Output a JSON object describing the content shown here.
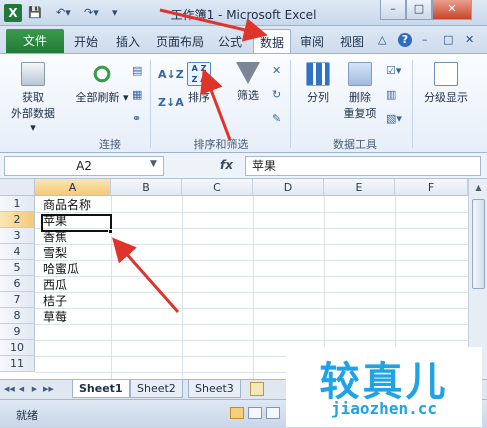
{
  "window": {
    "title": "工作簿1 - Microsoft Excel",
    "logo_letter": "X",
    "minimize_glyph": "–",
    "restore_glyph": "□",
    "close_glyph": "✕"
  },
  "quick_access": {
    "save": "💾",
    "undo": "↶▾",
    "redo": "↷▾",
    "customize": "▾"
  },
  "tabs": {
    "file": "文件",
    "items": [
      "开始",
      "插入",
      "页面布局",
      "公式",
      "数据",
      "审阅",
      "视图"
    ],
    "active": "数据",
    "right_icons": [
      "△",
      "?",
      "–",
      "□",
      "✕"
    ]
  },
  "ribbon": {
    "buttons": {
      "get_external_line1": "获取",
      "get_external_line2": "外部数据 ▾",
      "refresh_all": "全部刷新 ▾",
      "sort": "排序",
      "filter": "筛选",
      "split": "分列",
      "remove_dup_line1": "删除",
      "remove_dup_line2": "重复项",
      "outline": "分级显示",
      "sort_az": "A↓Z",
      "sort_za": "Z↓A"
    },
    "groups": {
      "connections": "连接",
      "sort_filter": "排序和筛选",
      "data_tools": "数据工具"
    }
  },
  "formula_bar": {
    "name_box": "A2",
    "fx": "fx",
    "content": "苹果"
  },
  "grid": {
    "columns": [
      "A",
      "B",
      "C",
      "D",
      "E",
      "F"
    ],
    "rows": [
      "1",
      "2",
      "3",
      "4",
      "5",
      "6",
      "7",
      "8",
      "9",
      "10",
      "11"
    ],
    "cells_a": [
      "商品名称",
      "苹果",
      "香蕉",
      "雪梨",
      "哈蜜瓜",
      "西瓜",
      "桔子",
      "草莓",
      "",
      "",
      ""
    ]
  },
  "sheets": {
    "nav": [
      "◀◀",
      "◀",
      "▶",
      "▶▶"
    ],
    "tabs": [
      "Sheet1",
      "Sheet2",
      "Sheet3"
    ],
    "active": "Sheet1"
  },
  "status": {
    "text": "就绪"
  },
  "watermark": {
    "main": "较真儿",
    "url": "jiaozhen.cc"
  },
  "colors": {
    "excel_green": "#217a36",
    "arrow_red": "#e0332a",
    "watermark_blue": "#1ea3e6"
  }
}
